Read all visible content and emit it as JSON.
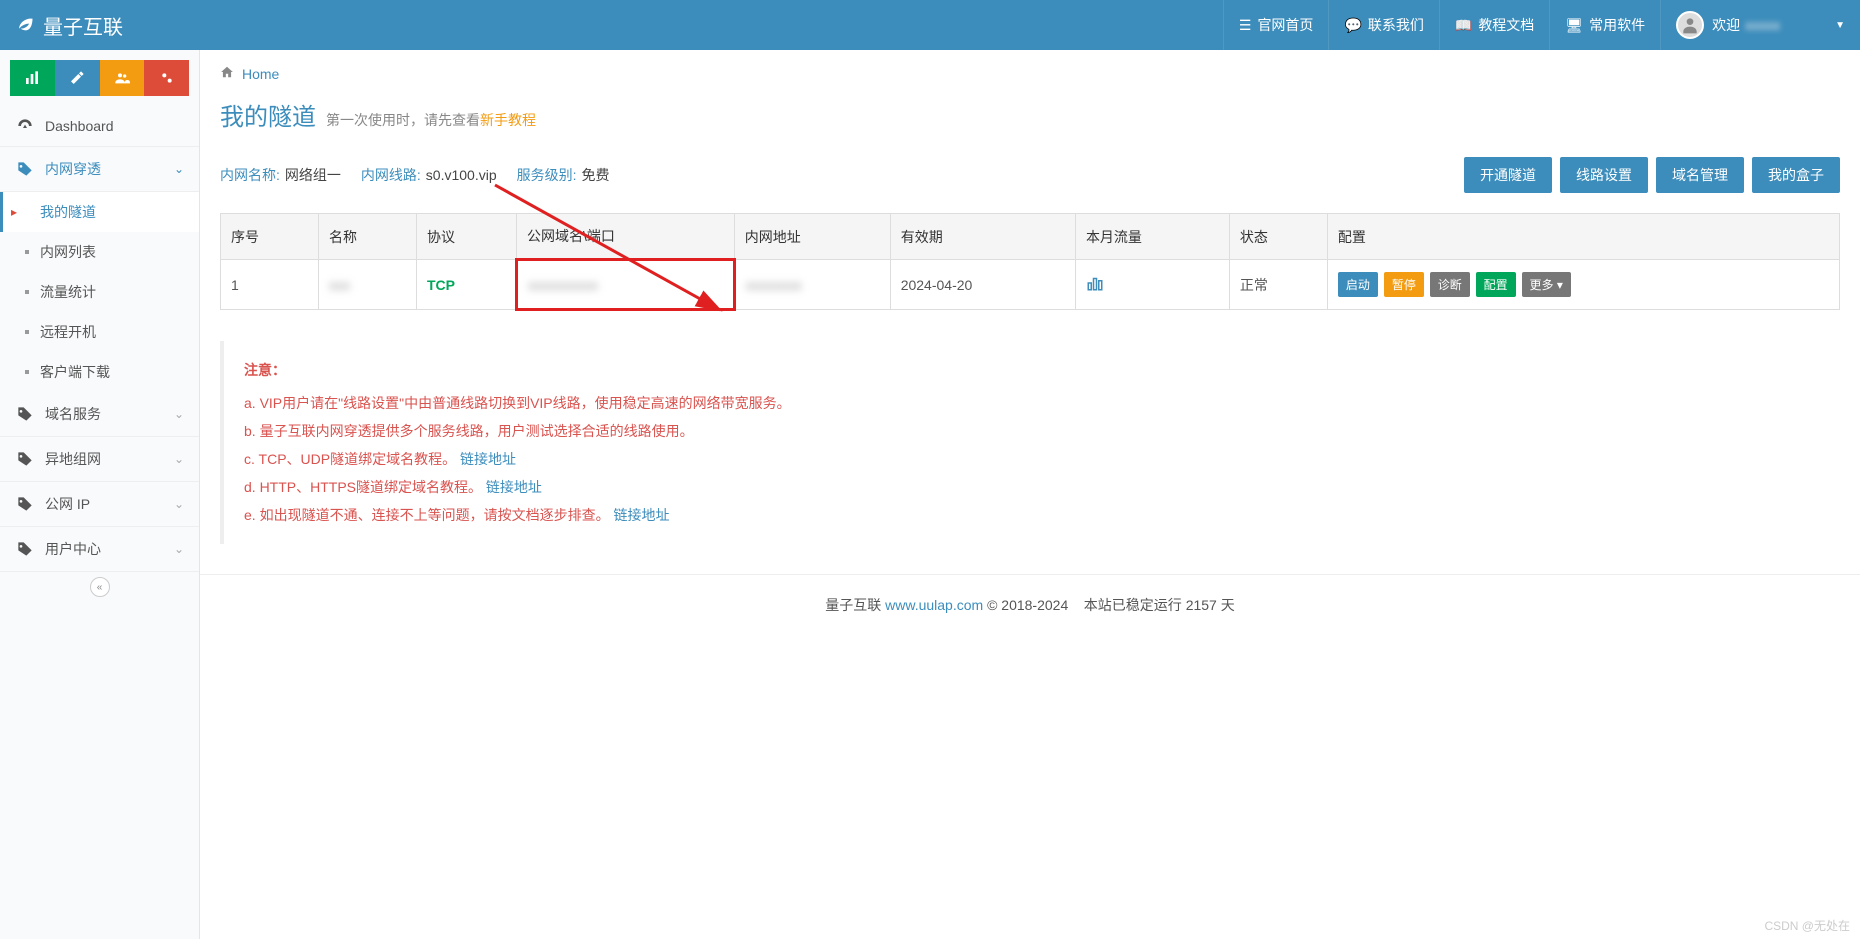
{
  "header": {
    "logo_text": "量子互联",
    "nav": {
      "home": "官网首页",
      "contact": "联系我们",
      "docs": "教程文档",
      "software": "常用软件"
    },
    "user_greeting": "欢迎"
  },
  "sidebar": {
    "dashboard": "Dashboard",
    "penetration": "内网穿透",
    "sub": {
      "my_tunnels": "我的隧道",
      "intranet_list": "内网列表",
      "traffic_stats": "流量统计",
      "remote_boot": "远程开机",
      "client_download": "客户端下载"
    },
    "domain_service": "域名服务",
    "remote_network": "异地组网",
    "public_ip": "公网 IP",
    "user_center": "用户中心"
  },
  "breadcrumb": {
    "home": "Home"
  },
  "page": {
    "title": "我的隧道",
    "subtitle_prefix": "第一次使用时，请先查看",
    "subtitle_link": "新手教程"
  },
  "info": {
    "name_label": "内网名称:",
    "name_value": "网络组一",
    "line_label": "内网线路:",
    "line_value": "s0.v100.vip",
    "level_label": "服务级别:",
    "level_value": "免费"
  },
  "actions": {
    "open_tunnel": "开通隧道",
    "line_settings": "线路设置",
    "domain_manage": "域名管理",
    "my_box": "我的盒子"
  },
  "table": {
    "headers": {
      "seq": "序号",
      "name": "名称",
      "protocol": "协议",
      "public_domain": "公网域名\\端口",
      "intranet_addr": "内网地址",
      "expiry": "有效期",
      "monthly_traffic": "本月流量",
      "status": "状态",
      "config": "配置"
    },
    "row": {
      "seq": "1",
      "name_blur": "xxx",
      "protocol": "TCP",
      "public_blur": "xxxxxxxxxx",
      "intranet_blur": "xxxxxxxx",
      "expiry": "2024-04-20",
      "status": "正常"
    },
    "row_actions": {
      "start": "启动",
      "pause": "暂停",
      "diagnose": "诊断",
      "config": "配置",
      "more": "更多"
    }
  },
  "notice": {
    "title": "注意：",
    "a": "a. VIP用户请在\"线路设置\"中由普通线路切换到VIP线路，使用稳定高速的网络带宽服务。",
    "b": "b. 量子互联内网穿透提供多个服务线路，用户测试选择合适的线路使用。",
    "c_prefix": "c. TCP、UDP隧道绑定域名教程。",
    "d_prefix": "d. HTTP、HTTPS隧道绑定域名教程。",
    "e_prefix": "e. 如出现隧道不通、连接不上等问题，请按文档逐步排查。",
    "link_text": "链接地址"
  },
  "footer": {
    "brand": "量子互联",
    "url": "www.uulap.com",
    "copyright": "© 2018-2024",
    "uptime_prefix": "本站已稳定运行",
    "uptime_days": "2157",
    "uptime_suffix": "天"
  },
  "watermark": "CSDN @无处在"
}
